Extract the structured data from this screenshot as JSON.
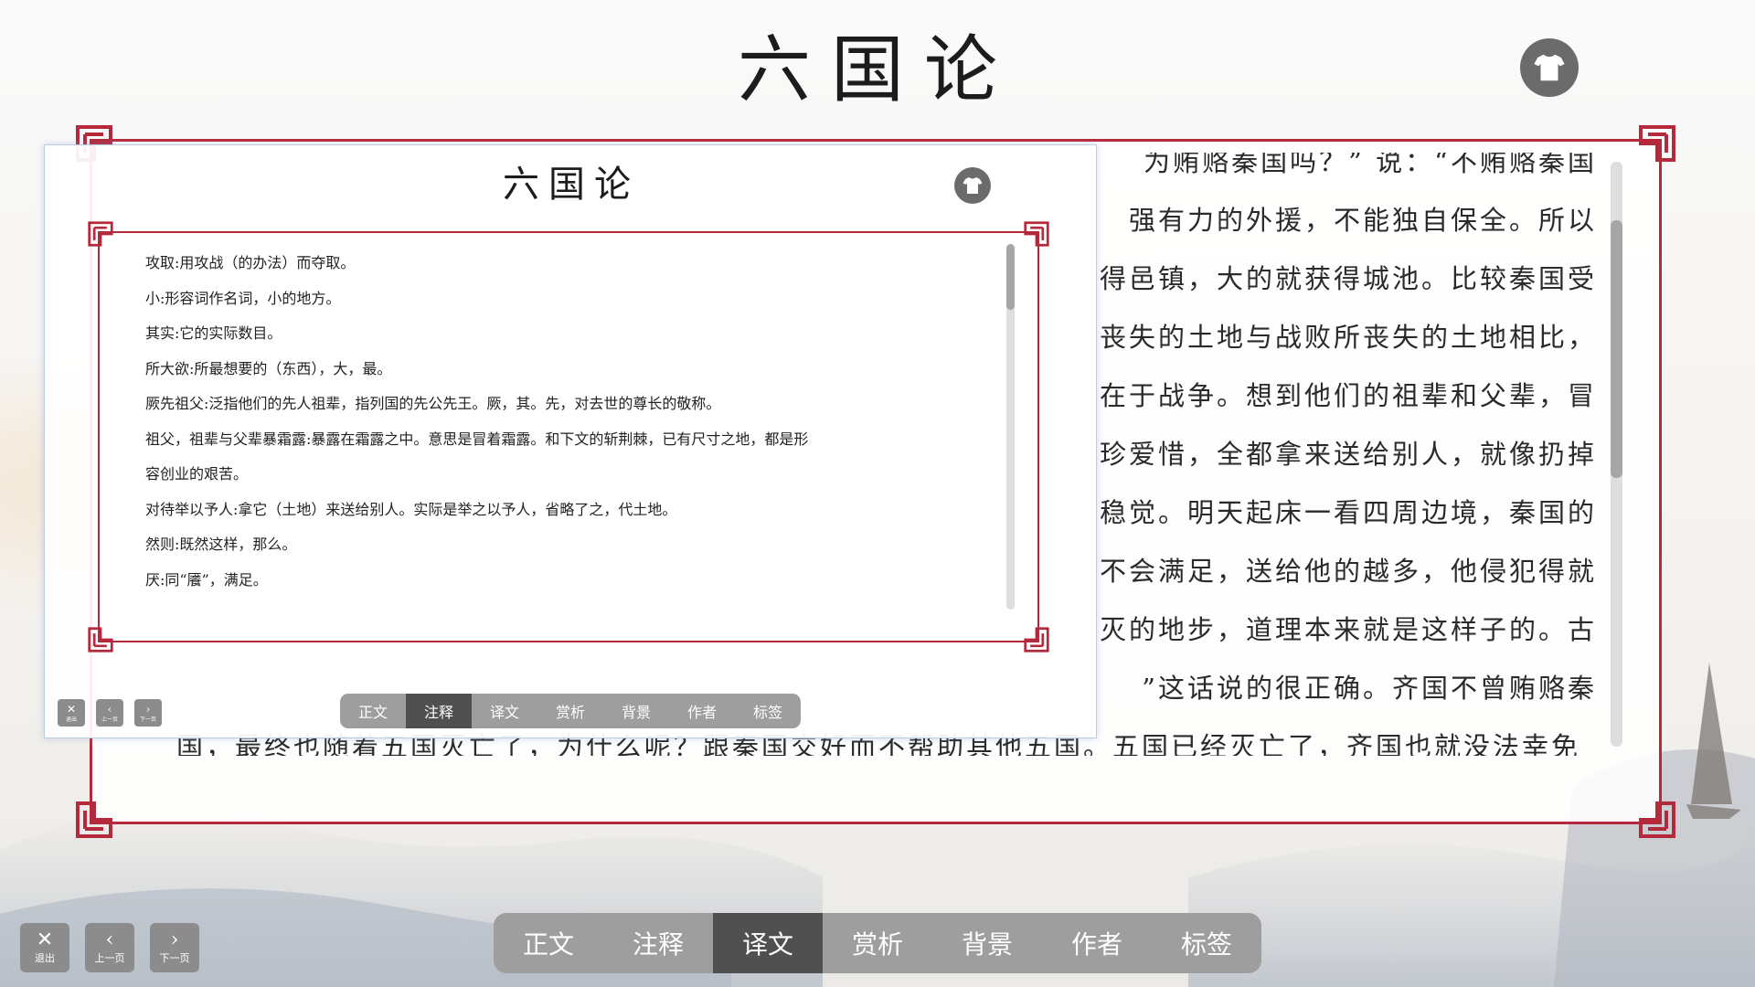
{
  "app": {
    "title": "六国论"
  },
  "main": {
    "lines": [
      "为贿赂秦国吗？” 说：“不贿赂秦国",
      "强有力的外援，不能独自保全。所以",
      "得邑镇，大的就获得城池。比较秦国受",
      "丧失的土地与战败所丧失的土地相比，",
      "在于战争。想到他们的祖辈和父辈，冒",
      "珍爱惜，全都拿来送给别人，就像扔掉",
      "稳觉。明天起床一看四周边境，秦国的",
      "不会满足，送给他的越多，他侵犯得就",
      "灭的地步，道理本来就是这样子的。古",
      "”这话说的很正确。齐国不曾贿赂秦",
      "国，最终也随着五国灭亡了，为什么呢？跟秦国交好而不帮助其他五国。五国已经灭亡了，齐国也就没法幸免"
    ],
    "tabs": [
      {
        "label": "正文",
        "active": false
      },
      {
        "label": "注释",
        "active": false
      },
      {
        "label": "译文",
        "active": true
      },
      {
        "label": "赏析",
        "active": false
      },
      {
        "label": "背景",
        "active": false
      },
      {
        "label": "作者",
        "active": false
      },
      {
        "label": "标签",
        "active": false
      }
    ],
    "nav": {
      "exit": "退出",
      "prev": "上一页",
      "next": "下一页"
    },
    "scroll_position": 0.18
  },
  "popup": {
    "title": "六国论",
    "notes": [
      "攻取:用攻战（的办法）而夺取。",
      "小:形容词作名词，小的地方。",
      "其实:它的实际数目。",
      "所大欲:所最想要的（东西），大，最。",
      "厥先祖父:泛指他们的先人祖辈，指列国的先公先王。厥，其。先，对去世的尊长的敬称。",
      "祖父，祖辈与父辈暴霜露:暴露在霜露之中。意思是冒着霜露。和下文的斩荆棘，已有尺寸之地，都是形",
      "容创业的艰苦。",
      "对待举以予人:拿它（土地）来送给别人。实际是举之以予人，省略了之，代土地。",
      "然则:既然这样，那么。",
      "厌:同“餍”，满足。"
    ],
    "tabs": [
      {
        "label": "正文",
        "active": false
      },
      {
        "label": "注释",
        "active": true
      },
      {
        "label": "译文",
        "active": false
      },
      {
        "label": "赏析",
        "active": false
      },
      {
        "label": "背景",
        "active": false
      },
      {
        "label": "作者",
        "active": false
      },
      {
        "label": "标签",
        "active": false
      }
    ],
    "nav": {
      "exit": "退出",
      "prev": "上一页",
      "next": "下一页"
    }
  },
  "colors": {
    "frame": "#b5293c",
    "tab_bar": "#9e9e9e",
    "tab_active": "#505050",
    "button": "#6b6b6b"
  },
  "icons": {
    "skin": "tshirt-icon",
    "exit": "close-icon",
    "prev": "chevron-left-icon",
    "next": "chevron-right-icon"
  }
}
